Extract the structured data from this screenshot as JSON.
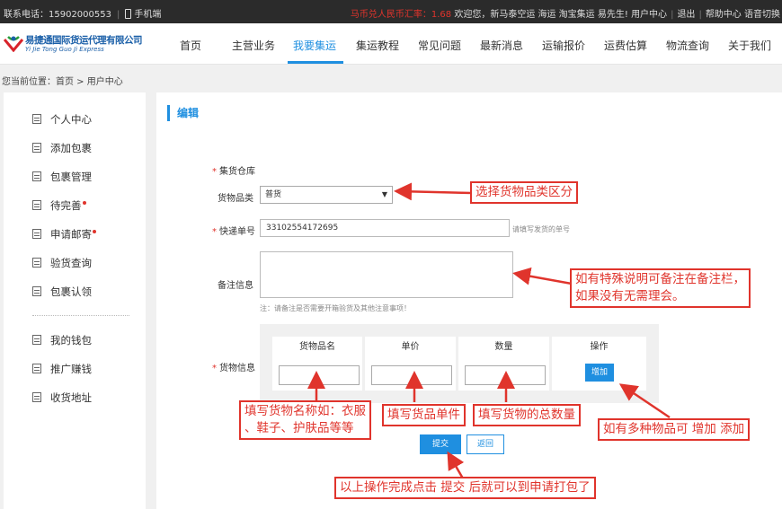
{
  "topbar": {
    "phone": "联系电话：15902000553",
    "mobile": "手机端",
    "rate": "马币兑人民币汇率：1.68",
    "welcome": "欢迎您，新马泰空运 海运 淘宝集运 易先生!",
    "user_center": "用户中心",
    "logout": "退出",
    "help": "帮助中心",
    "lang": "语音切换"
  },
  "logo": {
    "cn": "易捷通国际货运代理有限公司",
    "en": "Yi Jie Tong Guo Ji Express"
  },
  "nav": [
    "首页",
    "主营业务",
    "我要集运",
    "集运教程",
    "常见问题",
    "最新消息",
    "运输报价",
    "运费估算",
    "物流查询",
    "关于我们"
  ],
  "breadcrumb": "您当前位置：首页 > 用户中心",
  "sidebar": {
    "group1": [
      "个人中心",
      "添加包裹",
      "包裹管理",
      "待完善",
      "申请邮寄",
      "验货查询",
      "包裹认领"
    ],
    "group2": [
      "我的钱包",
      "推广赚钱",
      "收货地址"
    ]
  },
  "form": {
    "title": "编辑",
    "warehouse_label": "集货仓库",
    "category_label": "货物品类",
    "category_value": "普货",
    "tracking_label": "快递单号",
    "tracking_value": "33102554172695",
    "tracking_hint": "请填写发货的单号",
    "remark_label": "备注信息",
    "remark_hint": "注：请备注是否需要开箱验货及其他注意事项！",
    "goods_label": "货物信息",
    "columns": [
      "货物品名",
      "单价",
      "数量",
      "操作"
    ],
    "add_button": "增加",
    "submit_button": "提交",
    "back_button": "返回"
  },
  "annotations": {
    "category": "选择货物品类区分",
    "remark_line1": "如有特殊说明可备注在备注栏，",
    "remark_line2": "如果没有无需理会。",
    "name_line1": "填写货物名称如：衣服",
    "name_line2": "、鞋子、护肤品等等",
    "price": "填写货品单件",
    "qty": "填写货物的总数量",
    "add": "如有多种物品可 增加 添加",
    "submit": "以上操作完成点击 提交 后就可以到申请打包了"
  }
}
